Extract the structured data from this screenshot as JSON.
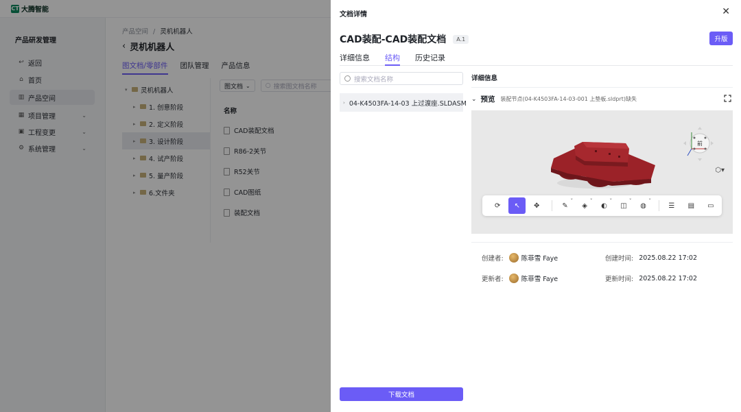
{
  "app": {
    "logo_mark": "CT",
    "logo_text": "大腾智能"
  },
  "sidebar": {
    "section_title": "产品研发管理",
    "items": [
      {
        "label": "返回",
        "icon": "return-icon"
      },
      {
        "label": "首页",
        "icon": "home-icon"
      },
      {
        "label": "产品空间",
        "icon": "product-space-icon",
        "active": true
      },
      {
        "label": "项目管理",
        "icon": "project-icon",
        "expandable": true
      },
      {
        "label": "工程变更",
        "icon": "change-icon",
        "expandable": true
      },
      {
        "label": "系统管理",
        "icon": "gear-icon",
        "expandable": true
      }
    ]
  },
  "main": {
    "breadcrumb": {
      "root": "产品空间",
      "sep": "/",
      "current": "灵机机器人"
    },
    "title": "灵机机器人",
    "tabs": [
      "图文档/零部件",
      "团队管理",
      "产品信息"
    ],
    "tree": [
      {
        "label": "灵机机器人",
        "level": 0
      },
      {
        "label": "1. 创意阶段",
        "level": 1
      },
      {
        "label": "2. 定义阶段",
        "level": 1
      },
      {
        "label": "3. 设计阶段",
        "level": 1,
        "selected": true
      },
      {
        "label": "4. 试产阶段",
        "level": 1
      },
      {
        "label": "5. 量产阶段",
        "level": 1
      },
      {
        "label": "6.文件夹",
        "level": 1
      }
    ],
    "filter_select": "图文档",
    "search_placeholder": "搜索图文档名称",
    "list_header": "名称",
    "list_items": [
      "CAD装配文档",
      "R86-2关节",
      "R52关节",
      "CAD图纸",
      "装配文档"
    ]
  },
  "drawer": {
    "header": "文档详情",
    "close_glyph": "✕",
    "title": "CAD装配-CAD装配文档",
    "version": "A.1",
    "upgrade_label": "升版",
    "tabs": [
      "详细信息",
      "结构",
      "历史记录"
    ],
    "active_tab": 1,
    "tree_search_placeholder": "搜索文档名称",
    "tree_node": "04-K4503FA-14-03 上过渡座.SLDASM",
    "detail_label": "详细信息",
    "preview_label": "预览",
    "preview_missing": "装配节点(04-K4503FA-14-03-001 上垫板.sldprt)缺失",
    "viewer_face_label": "前",
    "toolbar_tools": [
      {
        "icon": "reset-view-icon",
        "glyph": "⟳"
      },
      {
        "icon": "select-pointer-icon",
        "glyph": "↖",
        "active": true
      },
      {
        "icon": "move-icon",
        "glyph": "✥"
      },
      {
        "icon": "measure-icon",
        "glyph": "✎",
        "dropdown": true
      },
      {
        "icon": "section-icon",
        "glyph": "◈",
        "dropdown": true
      },
      {
        "icon": "explode-icon",
        "glyph": "◐",
        "dropdown": true
      },
      {
        "icon": "split-view-icon",
        "glyph": "◫",
        "dropdown": true
      },
      {
        "icon": "render-mode-icon",
        "glyph": "◍",
        "dropdown": true
      },
      {
        "icon": "structure-tree-icon",
        "glyph": "☰"
      },
      {
        "icon": "properties-icon",
        "glyph": "▤"
      },
      {
        "icon": "comment-icon",
        "glyph": "▭"
      }
    ],
    "creator_label": "创建者:",
    "creator_name": "陈菲雪 Faye",
    "created_time_label": "创建时间:",
    "created_time": "2025.08.22 17:02",
    "updater_label": "更新者:",
    "updater_name": "陈菲雪 Faye",
    "updated_time_label": "更新时间:",
    "updated_time": "2025.08.22 17:02",
    "download_label": "下载文档"
  },
  "colors": {
    "accent": "#6b5cf6",
    "model": "#8a1c22"
  }
}
